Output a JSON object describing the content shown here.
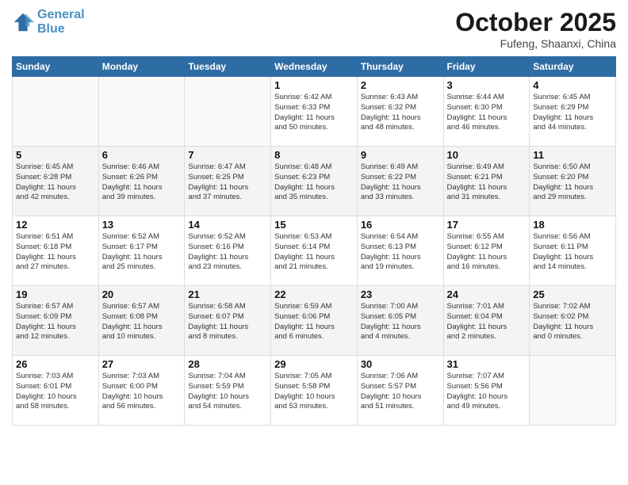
{
  "header": {
    "logo_line1": "General",
    "logo_line2": "Blue",
    "month": "October 2025",
    "location": "Fufeng, Shaanxi, China"
  },
  "weekdays": [
    "Sunday",
    "Monday",
    "Tuesday",
    "Wednesday",
    "Thursday",
    "Friday",
    "Saturday"
  ],
  "weeks": [
    [
      {
        "day": "",
        "info": ""
      },
      {
        "day": "",
        "info": ""
      },
      {
        "day": "",
        "info": ""
      },
      {
        "day": "1",
        "info": "Sunrise: 6:42 AM\nSunset: 6:33 PM\nDaylight: 11 hours\nand 50 minutes."
      },
      {
        "day": "2",
        "info": "Sunrise: 6:43 AM\nSunset: 6:32 PM\nDaylight: 11 hours\nand 48 minutes."
      },
      {
        "day": "3",
        "info": "Sunrise: 6:44 AM\nSunset: 6:30 PM\nDaylight: 11 hours\nand 46 minutes."
      },
      {
        "day": "4",
        "info": "Sunrise: 6:45 AM\nSunset: 6:29 PM\nDaylight: 11 hours\nand 44 minutes."
      }
    ],
    [
      {
        "day": "5",
        "info": "Sunrise: 6:45 AM\nSunset: 6:28 PM\nDaylight: 11 hours\nand 42 minutes."
      },
      {
        "day": "6",
        "info": "Sunrise: 6:46 AM\nSunset: 6:26 PM\nDaylight: 11 hours\nand 39 minutes."
      },
      {
        "day": "7",
        "info": "Sunrise: 6:47 AM\nSunset: 6:25 PM\nDaylight: 11 hours\nand 37 minutes."
      },
      {
        "day": "8",
        "info": "Sunrise: 6:48 AM\nSunset: 6:23 PM\nDaylight: 11 hours\nand 35 minutes."
      },
      {
        "day": "9",
        "info": "Sunrise: 6:49 AM\nSunset: 6:22 PM\nDaylight: 11 hours\nand 33 minutes."
      },
      {
        "day": "10",
        "info": "Sunrise: 6:49 AM\nSunset: 6:21 PM\nDaylight: 11 hours\nand 31 minutes."
      },
      {
        "day": "11",
        "info": "Sunrise: 6:50 AM\nSunset: 6:20 PM\nDaylight: 11 hours\nand 29 minutes."
      }
    ],
    [
      {
        "day": "12",
        "info": "Sunrise: 6:51 AM\nSunset: 6:18 PM\nDaylight: 11 hours\nand 27 minutes."
      },
      {
        "day": "13",
        "info": "Sunrise: 6:52 AM\nSunset: 6:17 PM\nDaylight: 11 hours\nand 25 minutes."
      },
      {
        "day": "14",
        "info": "Sunrise: 6:52 AM\nSunset: 6:16 PM\nDaylight: 11 hours\nand 23 minutes."
      },
      {
        "day": "15",
        "info": "Sunrise: 6:53 AM\nSunset: 6:14 PM\nDaylight: 11 hours\nand 21 minutes."
      },
      {
        "day": "16",
        "info": "Sunrise: 6:54 AM\nSunset: 6:13 PM\nDaylight: 11 hours\nand 19 minutes."
      },
      {
        "day": "17",
        "info": "Sunrise: 6:55 AM\nSunset: 6:12 PM\nDaylight: 11 hours\nand 16 minutes."
      },
      {
        "day": "18",
        "info": "Sunrise: 6:56 AM\nSunset: 6:11 PM\nDaylight: 11 hours\nand 14 minutes."
      }
    ],
    [
      {
        "day": "19",
        "info": "Sunrise: 6:57 AM\nSunset: 6:09 PM\nDaylight: 11 hours\nand 12 minutes."
      },
      {
        "day": "20",
        "info": "Sunrise: 6:57 AM\nSunset: 6:08 PM\nDaylight: 11 hours\nand 10 minutes."
      },
      {
        "day": "21",
        "info": "Sunrise: 6:58 AM\nSunset: 6:07 PM\nDaylight: 11 hours\nand 8 minutes."
      },
      {
        "day": "22",
        "info": "Sunrise: 6:59 AM\nSunset: 6:06 PM\nDaylight: 11 hours\nand 6 minutes."
      },
      {
        "day": "23",
        "info": "Sunrise: 7:00 AM\nSunset: 6:05 PM\nDaylight: 11 hours\nand 4 minutes."
      },
      {
        "day": "24",
        "info": "Sunrise: 7:01 AM\nSunset: 6:04 PM\nDaylight: 11 hours\nand 2 minutes."
      },
      {
        "day": "25",
        "info": "Sunrise: 7:02 AM\nSunset: 6:02 PM\nDaylight: 11 hours\nand 0 minutes."
      }
    ],
    [
      {
        "day": "26",
        "info": "Sunrise: 7:03 AM\nSunset: 6:01 PM\nDaylight: 10 hours\nand 58 minutes."
      },
      {
        "day": "27",
        "info": "Sunrise: 7:03 AM\nSunset: 6:00 PM\nDaylight: 10 hours\nand 56 minutes."
      },
      {
        "day": "28",
        "info": "Sunrise: 7:04 AM\nSunset: 5:59 PM\nDaylight: 10 hours\nand 54 minutes."
      },
      {
        "day": "29",
        "info": "Sunrise: 7:05 AM\nSunset: 5:58 PM\nDaylight: 10 hours\nand 53 minutes."
      },
      {
        "day": "30",
        "info": "Sunrise: 7:06 AM\nSunset: 5:57 PM\nDaylight: 10 hours\nand 51 minutes."
      },
      {
        "day": "31",
        "info": "Sunrise: 7:07 AM\nSunset: 5:56 PM\nDaylight: 10 hours\nand 49 minutes."
      },
      {
        "day": "",
        "info": ""
      }
    ]
  ]
}
